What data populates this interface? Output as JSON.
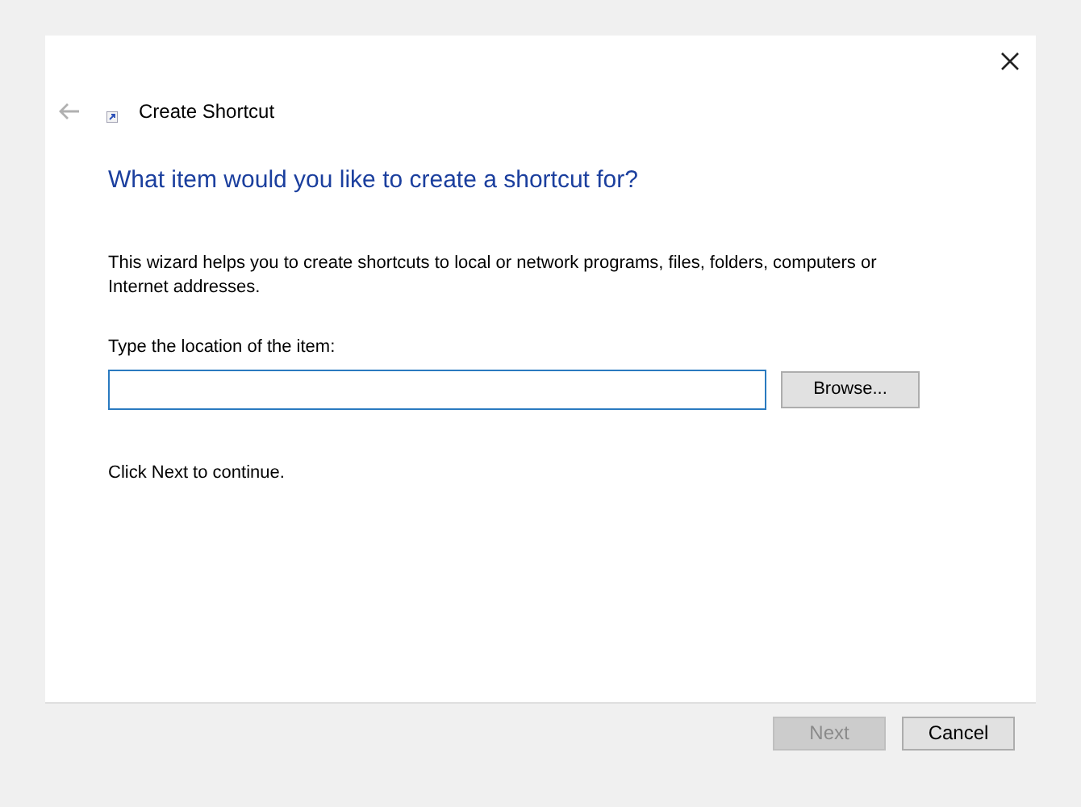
{
  "window": {
    "title": "Create Shortcut"
  },
  "heading": "What item would you like to create a shortcut for?",
  "description": "This wizard helps you to create shortcuts to local or network programs, files, folders, computers or Internet addresses.",
  "location": {
    "label": "Type the location of the item:",
    "browse": "Browse..."
  },
  "hint": "Click Next to continue.",
  "buttons": [
    {
      "label": "Next",
      "disabled": true
    },
    {
      "label": "Cancel",
      "disabled": false
    }
  ]
}
